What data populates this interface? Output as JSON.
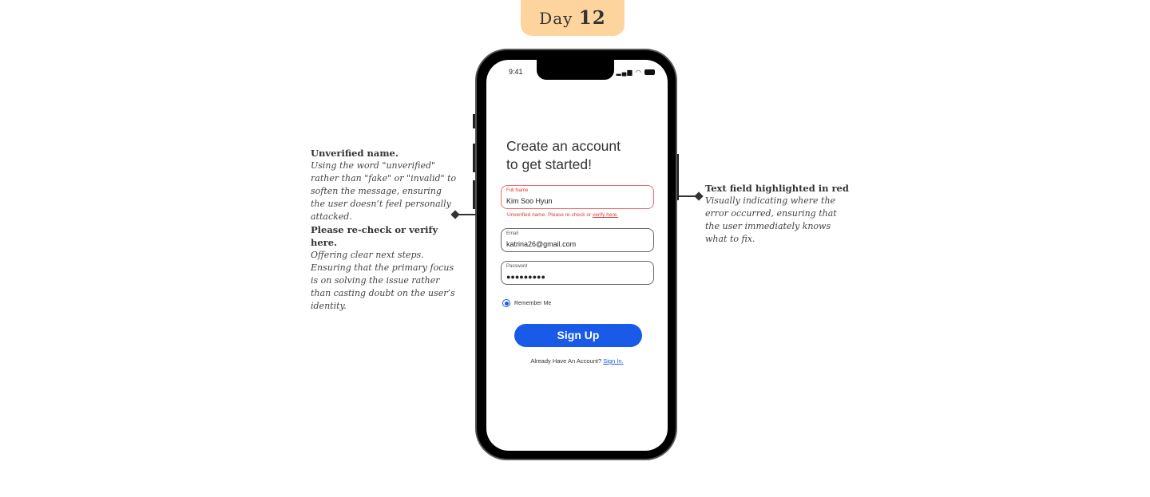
{
  "badge": {
    "label": "Day",
    "number": "12"
  },
  "phone": {
    "time": "9:41",
    "status_icons": "signal wifi battery"
  },
  "form": {
    "title_line1": "Create an account",
    "title_line2": "to get started!",
    "full_name": {
      "label": "Full Name",
      "value": "Kim Soo Hyun"
    },
    "error": {
      "text": "Unverified name. Please re-check or ",
      "link": "verify here."
    },
    "email": {
      "label": "Email",
      "value": "katrina26@gmail.com"
    },
    "password": {
      "label": "Password",
      "value": "●●●●●●●●●"
    },
    "remember": "Remember Me",
    "signup": "Sign Up",
    "signin_text": "Already Have An Account? ",
    "signin_link": "Sign In."
  },
  "notes": {
    "left1": {
      "title": "Unverified name.",
      "body": "Using the word \"unverified\" rather than \"fake\" or \"invalid\" to soften the message, ensuring the user doesn’t feel personally attacked."
    },
    "left2": {
      "title": "Please re-check or verify here.",
      "body": "Offering clear next steps. Ensuring that the primary focus is on solving the issue rather than casting doubt on the user’s identity."
    },
    "right": {
      "title": "Text field highlighted in red",
      "body": "Visually indicating where the error occurred, ensuring that the user immediately knows what to fix."
    }
  },
  "colors": {
    "accent": "#1a5ae8",
    "error": "#e53935",
    "badge": "#fdd49e"
  }
}
